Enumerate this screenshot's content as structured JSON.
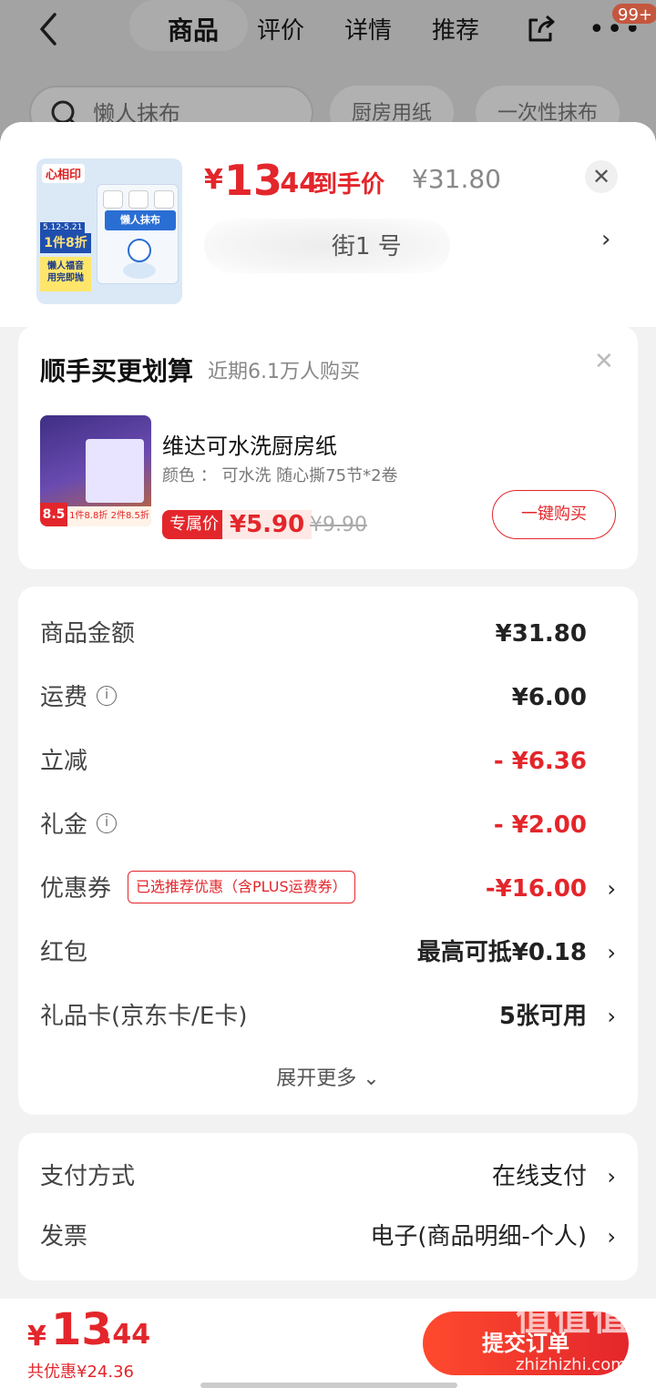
{
  "background": {
    "nav_tabs": [
      "商品",
      "评价",
      "详情",
      "推荐"
    ],
    "badge": "99+",
    "search_placeholder": "懒人抹布",
    "chips": [
      "厨房用纸",
      "一次性抹布"
    ]
  },
  "product": {
    "thumb": {
      "brand": "心相印",
      "date": "5.12-5.21",
      "deal": "1件8折",
      "tag_line1": "懒人福音",
      "tag_line2": "用完即抛",
      "pack_title": "懒人抹布"
    },
    "price_symbol": "¥",
    "price_int": "13",
    "price_dec": ".44",
    "price_label": "到手价",
    "original_price": "¥31.80",
    "address_partial": "街1 号"
  },
  "addon": {
    "title": "顺手买更划算",
    "subtitle": "近期6.1万人购买",
    "thumb_badge": "8.5",
    "thumb_deal": "1件8.8折 2件8.5折",
    "name": "维达可水洗厨房纸",
    "spec": "颜色 ： 可水洗  随心撕75节*2卷",
    "price_tag": "专属价",
    "price": "¥5.90",
    "orig_price": "¥9.90",
    "buy_label": "一键购买"
  },
  "fees": {
    "rows": [
      {
        "label": "商品金额",
        "value": "¥31.80"
      },
      {
        "label": "运费",
        "value": "¥6.00"
      },
      {
        "label": "立减",
        "value": "- ¥6.36"
      },
      {
        "label": "礼金",
        "value": "- ¥2.00"
      },
      {
        "label": "优惠券",
        "pill": "已选推荐优惠（含PLUS运费券）",
        "value": "-¥16.00"
      },
      {
        "label": "红包",
        "value": "最高可抵¥0.18"
      },
      {
        "label": "礼品卡(京东卡/E卡)",
        "value": "5张可用"
      }
    ],
    "expand_label": "展开更多 ⌄"
  },
  "payment": {
    "method_label": "支付方式",
    "method_value": "在线支付",
    "invoice_label": "发票",
    "invoice_value": "电子(商品明细-个人)"
  },
  "footer": {
    "total_symbol": "¥",
    "total_int": "13",
    "total_dec": ".44",
    "savings": "共优惠¥24.36",
    "submit_label": "提交订单"
  },
  "watermark": {
    "glyphs": "值值值",
    "text": "zhizhizhi.com"
  },
  "colors": {
    "accent": "#e3262b",
    "sheet_bg": "#f2f2f2",
    "overlay": "#8f8f8f"
  }
}
